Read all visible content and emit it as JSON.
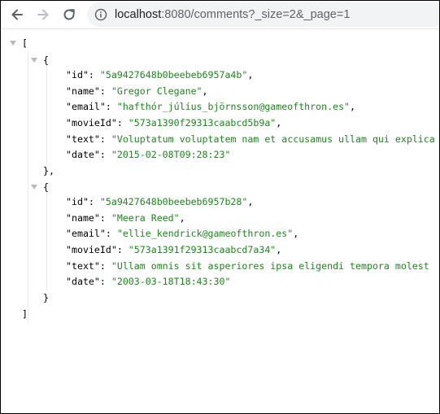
{
  "browser": {
    "url_host": "localhost",
    "url_rest": ":8080/comments?_size=2&_page=1"
  },
  "json": {
    "open_bracket": "[",
    "close_bracket": "]",
    "open_brace": "{",
    "close_brace_comma": "},",
    "close_brace": "}",
    "items": [
      {
        "fields": [
          {
            "key": "\"id\"",
            "value": "\"5a9427648b0beebeb6957a4b\"",
            "trail": ","
          },
          {
            "key": "\"name\"",
            "value": "\"Gregor Clegane\"",
            "trail": ","
          },
          {
            "key": "\"email\"",
            "value": "\"hafthór_júlíus_björnsson@gameofthron.es\"",
            "trail": ","
          },
          {
            "key": "\"movieId\"",
            "value": "\"573a1390f29313caabcd5b9a\"",
            "trail": ","
          },
          {
            "key": "\"text\"",
            "value": "\"Voluptatum voluptatem nam et accusamus ullam qui explica",
            "trail": ""
          },
          {
            "key": "\"date\"",
            "value": "\"2015-02-08T09:28:23\"",
            "trail": ""
          }
        ]
      },
      {
        "fields": [
          {
            "key": "\"id\"",
            "value": "\"5a9427648b0beebeb6957b28\"",
            "trail": ","
          },
          {
            "key": "\"name\"",
            "value": "\"Meera Reed\"",
            "trail": ","
          },
          {
            "key": "\"email\"",
            "value": "\"ellie_kendrick@gameofthron.es\"",
            "trail": ","
          },
          {
            "key": "\"movieId\"",
            "value": "\"573a1391f29313caabcd7a34\"",
            "trail": ","
          },
          {
            "key": "\"text\"",
            "value": "\"Ullam omnis sit asperiores ipsa eligendi tempora molest",
            "trail": ""
          },
          {
            "key": "\"date\"",
            "value": "\"2003-03-18T18:43:30\"",
            "trail": ""
          }
        ]
      }
    ]
  }
}
